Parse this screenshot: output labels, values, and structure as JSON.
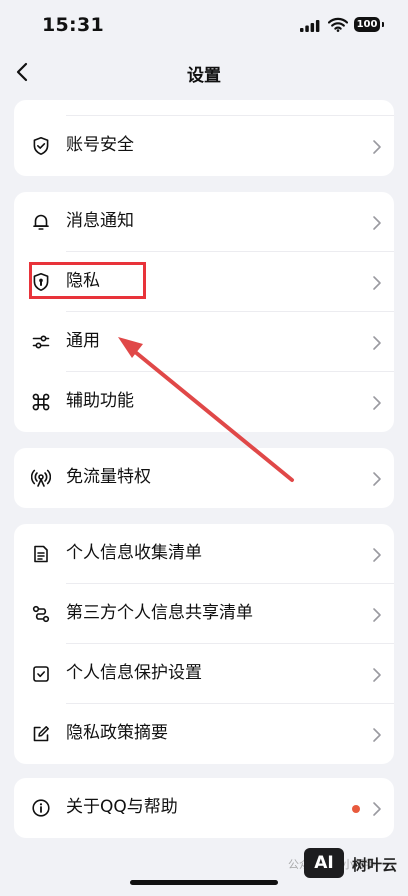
{
  "status": {
    "time": "15:31",
    "battery": "100"
  },
  "nav": {
    "title": "设置"
  },
  "sections": [
    {
      "items": [
        {
          "label": "账号安全",
          "icon": "shield-check-icon"
        }
      ]
    },
    {
      "items": [
        {
          "label": "消息通知",
          "icon": "bell-icon"
        },
        {
          "label": "隐私",
          "icon": "privacy-shield-icon"
        },
        {
          "label": "通用",
          "icon": "sliders-icon"
        },
        {
          "label": "辅助功能",
          "icon": "command-icon"
        }
      ]
    },
    {
      "items": [
        {
          "label": "免流量特权",
          "icon": "broadcast-icon"
        }
      ]
    },
    {
      "items": [
        {
          "label": "个人信息收集清单",
          "icon": "document-list-icon"
        },
        {
          "label": "第三方个人信息共享清单",
          "icon": "share-link-icon"
        },
        {
          "label": "个人信息保护设置",
          "icon": "checkbox-icon"
        },
        {
          "label": "隐私政策摘要",
          "icon": "edit-icon"
        }
      ]
    },
    {
      "items": [
        {
          "label": "关于QQ与帮助",
          "icon": "info-icon",
          "badge": "red-dot"
        }
      ]
    }
  ],
  "annotation": {
    "highlight_color": "#e8333a",
    "arrow_color": "#e04848"
  },
  "watermark": {
    "left_text": "公众号 · 通小帮手",
    "logo_text": "AI",
    "brand": "树叶云"
  }
}
